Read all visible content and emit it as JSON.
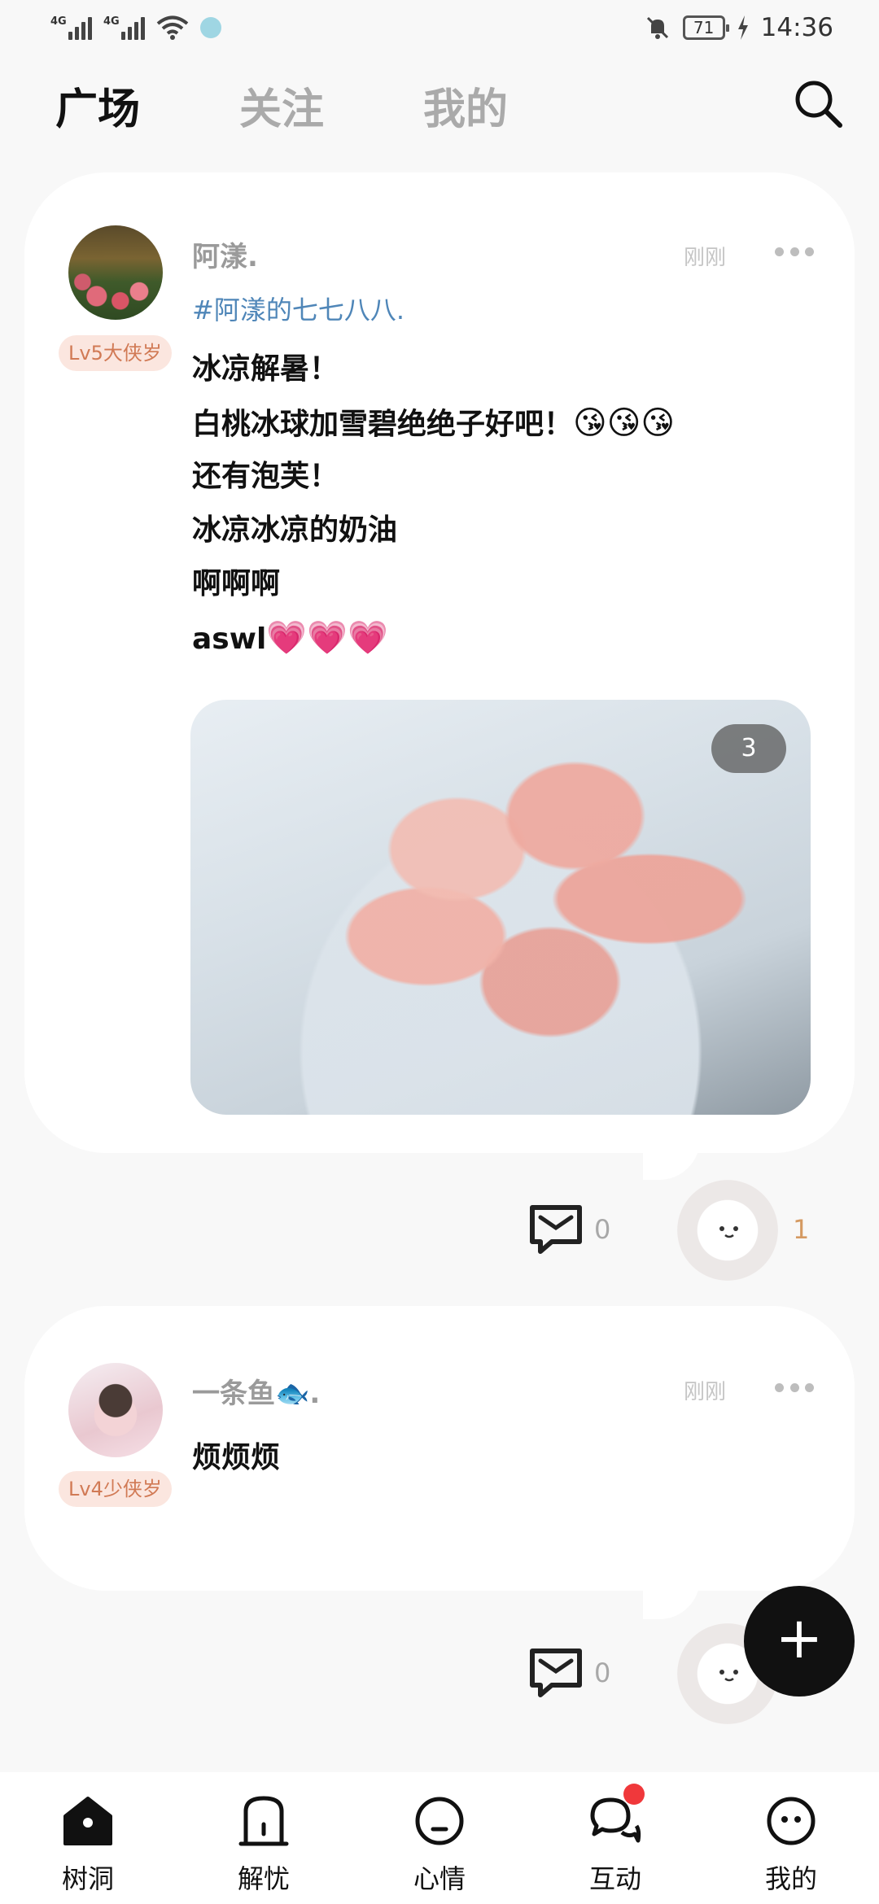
{
  "status_bar": {
    "network1": "4G",
    "network2": "4G",
    "battery": "71",
    "time": "14:36"
  },
  "top_tabs": [
    {
      "label": "广场",
      "active": true
    },
    {
      "label": "关注",
      "active": false
    },
    {
      "label": "我的",
      "active": false
    }
  ],
  "posts": [
    {
      "username": "阿漾.",
      "level": "Lv5大侠岁",
      "timestamp": "刚刚",
      "topic": "#阿漾的七七八八.",
      "lines": [
        "冰凉解暑！",
        "白桃冰球加雪碧绝绝子好吧！",
        "还有泡芙！",
        "冰凉冰凉的奶油",
        "啊啊啊",
        "aswl"
      ],
      "emoji_line2": "😘😘😘",
      "emoji_line6": "💗💗💗",
      "image_count": "3",
      "comment_count": "0",
      "reaction_count": "1"
    },
    {
      "username": "一条鱼🐟.",
      "level": "Lv4少侠岁",
      "timestamp": "刚刚",
      "text": "烦烦烦",
      "comment_count": "0"
    }
  ],
  "fab": {
    "icon": "plus-icon",
    "label": "+"
  },
  "bottom_nav": [
    {
      "label": "树洞",
      "icon": "home-icon",
      "active": true
    },
    {
      "label": "解忧",
      "icon": "door-icon",
      "active": false
    },
    {
      "label": "心情",
      "icon": "mood-icon",
      "active": false
    },
    {
      "label": "互动",
      "icon": "chat-icon",
      "active": false,
      "badge": true
    },
    {
      "label": "我的",
      "icon": "profile-icon",
      "active": false
    }
  ],
  "colors": {
    "background": "#f8f8f8",
    "card": "#ffffff",
    "accent_text": "#111111",
    "topic": "#4f86b8",
    "level_badge_bg": "#fbe6df",
    "level_badge_text": "#d17a55",
    "reaction_count": "#d59a62",
    "badge_red": "#f0383b"
  }
}
